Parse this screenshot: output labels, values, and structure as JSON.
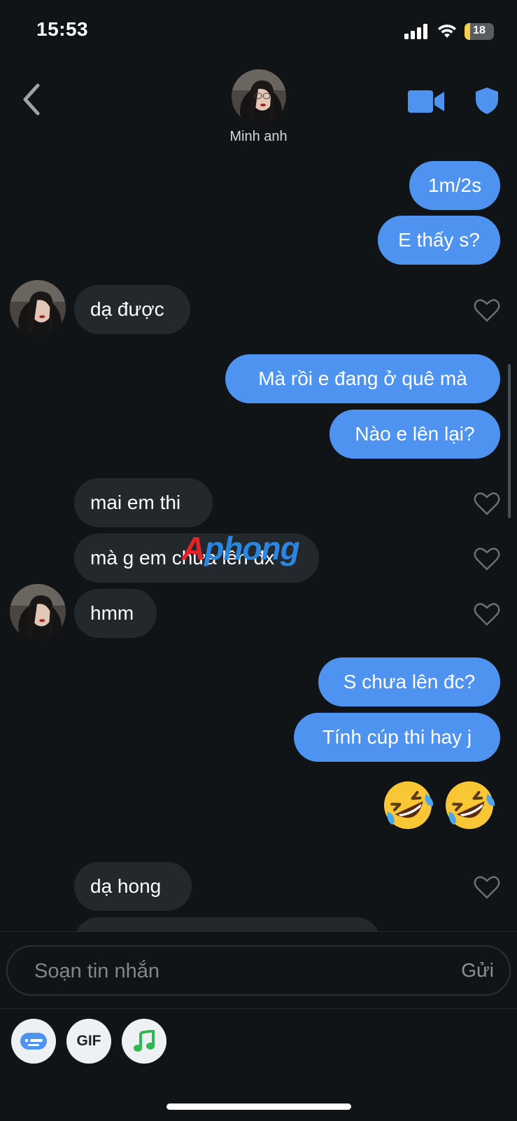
{
  "status_bar": {
    "time": "15:53",
    "battery": "18"
  },
  "header": {
    "contact_name": "Minh anh"
  },
  "messages": [
    {
      "dir": "out",
      "text": "1m/2s"
    },
    {
      "dir": "out",
      "text": "E thấy s?"
    },
    {
      "dir": "in",
      "text": "dạ được"
    },
    {
      "dir": "out",
      "text": "Mà rồi e đang ở quê mà"
    },
    {
      "dir": "out",
      "text": "Nào e lên lại?"
    },
    {
      "dir": "in",
      "text": "mai em thi"
    },
    {
      "dir": "in",
      "text": "mà g em chưa lên đx"
    },
    {
      "dir": "in",
      "text": "hmm"
    },
    {
      "dir": "out",
      "text": "S chưa lên đc?"
    },
    {
      "dir": "out",
      "text": "Tính cúp thi hay j"
    },
    {
      "dir": "out",
      "emoji": "rolling-on-floor-laughing x2"
    },
    {
      "dir": "in",
      "text": "dạ hong"
    }
  ],
  "watermark": {
    "part1": "A",
    "part2": "phong"
  },
  "composer": {
    "placeholder": "Soạn tin nhắn",
    "send_label": "Gửi"
  },
  "toolbar": {
    "gif_label": "GIF"
  },
  "icons": [
    "chevron-left-icon",
    "video-camera-icon",
    "shield-icon",
    "heart-icon",
    "keyboard-card-icon",
    "music-note-icon"
  ],
  "colors": {
    "outgoing": "#4f93f1",
    "incoming": "#23282d",
    "background": "#111417"
  }
}
